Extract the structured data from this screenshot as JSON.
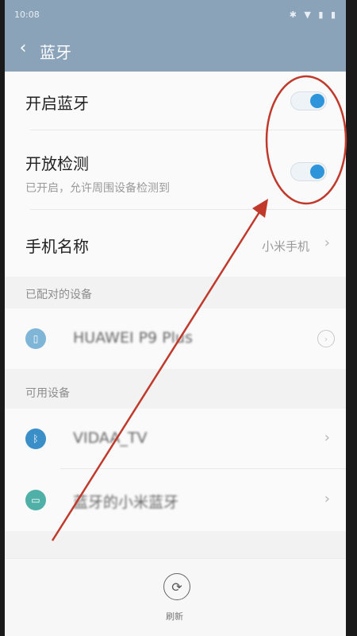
{
  "statusbar": {
    "time": "10:08",
    "icons": "✱ ▼ ▮ ▮"
  },
  "header": {
    "title": "蓝牙"
  },
  "settings": {
    "bluetooth": {
      "label": "开启蓝牙",
      "enabled": true
    },
    "visibility": {
      "label": "开放检测",
      "sublabel": "已开启，允许周围设备检测到",
      "enabled": true
    },
    "device_name": {
      "label": "手机名称",
      "value": "小米手机"
    }
  },
  "paired_section": {
    "header": "已配对的设备",
    "devices": [
      {
        "name": "HUAWEI P9 Plus",
        "icon": "phone-icon"
      }
    ]
  },
  "available_section": {
    "header": "可用设备",
    "devices": [
      {
        "name": "VIDAA_TV",
        "icon": "bluetooth-icon"
      },
      {
        "name": "蓝牙的小米蓝牙",
        "icon": "device-icon"
      }
    ]
  },
  "bottom": {
    "refresh_label": "刷新"
  },
  "colors": {
    "accent": "#2f95db",
    "header_bg": "#8aa3b8",
    "annotation": "#c0392b"
  }
}
